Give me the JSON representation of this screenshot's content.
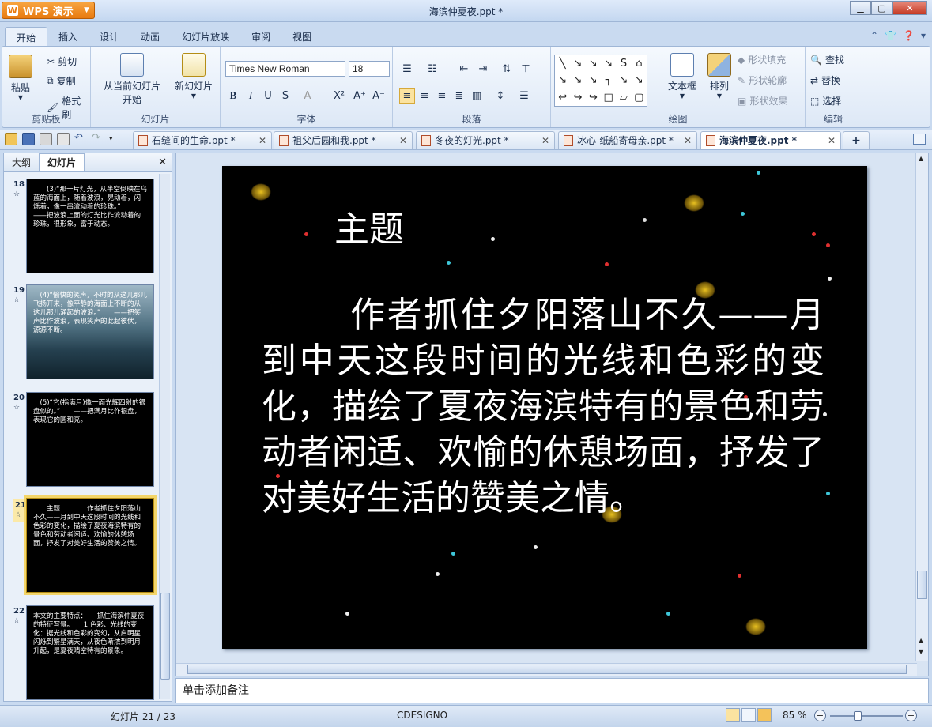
{
  "app": {
    "button_label": "WPS 演示",
    "window_title": "海滨仲夏夜.ppt *"
  },
  "menu": {
    "tabs": [
      "开始",
      "插入",
      "设计",
      "动画",
      "幻灯片放映",
      "审阅",
      "视图"
    ]
  },
  "ribbon": {
    "clipboard": {
      "paste": "粘贴",
      "cut": "剪切",
      "copy": "复制",
      "format_painter": "格式刷",
      "label": "剪贴板"
    },
    "slides": {
      "from_current": "从当前幻灯片",
      "start": "开始",
      "new_slide": "新幻灯片",
      "label": "幻灯片"
    },
    "font": {
      "family": "Times New Roman",
      "size": "18",
      "label": "字体"
    },
    "paragraph": {
      "label": "段落"
    },
    "drawing": {
      "textbox": "文本框",
      "arrange": "排列",
      "shape_fill": "形状填充",
      "shape_outline": "形状轮廓",
      "shape_effect": "形状效果",
      "label": "绘图"
    },
    "edit": {
      "find": "查找",
      "replace": "替换",
      "select": "选择",
      "label": "编辑"
    }
  },
  "doc_tabs": [
    {
      "title": "石缝间的生命.ppt *"
    },
    {
      "title": "祖父后园和我.ppt *"
    },
    {
      "title": "冬夜的灯光.ppt *"
    },
    {
      "title": "冰心-纸船寄母亲.ppt *"
    },
    {
      "title": "海滨仲夏夜.ppt *"
    }
  ],
  "left_panel": {
    "tabs": [
      "大纲",
      "幻灯片"
    ]
  },
  "thumbnails": [
    {
      "num": "18",
      "text": "　　(3)“那一片灯光，从半空倒映在乌蓝的海面上，随着波浪，晃动着，闪烁着，像一串流动着的珍珠。”　　　——把波浪上面的灯光比作流动着的珍珠，很形象，富于动态。"
    },
    {
      "num": "19",
      "text": "　(4)“愉快的笑声，不时的从这儿那儿飞扬开来，像平静的海面上不断的从这儿那儿涌起的波浪。”　　——把笑声比作波浪，表现笑声的此起彼伏，源源不断。"
    },
    {
      "num": "20",
      "text": "　(5)“它(指满月)像一面光辉四射的银盘似的。”　　——把满月比作银盘，表现它的圆和亮。"
    },
    {
      "num": "21",
      "text": "　　主题　　　　作者抓住夕阳落山不久——月到中天这段时间的光线和色彩的变化，描绘了夏夜海滨特有的景色和劳动者闲适、欢愉的休憩场面，抒发了对美好生活的赞美之情。"
    },
    {
      "num": "22",
      "text": "本文的主要特点：　　抓住海滨仲夏夜的特征写景。　　1.色彩、光线的变化：据光线和色彩的变幻，从启明星闪烁到繁星满天，从夜色渐浓到明月升起，是夏夜晴空特有的景象。"
    }
  ],
  "slide": {
    "title": "主题",
    "body": "作者抓住夕阳落山不久——月到中天这段时间的光线和色彩的变化，描绘了夏夜海滨特有的景色和劳动者闲适、欢愉的休憩场面，抒发了对美好生活的赞美之情。"
  },
  "notes": {
    "placeholder": "单击添加备注"
  },
  "status": {
    "slide_indicator": "幻灯片 21 / 23",
    "theme": "CDESIGNO",
    "zoom": "85 %"
  }
}
